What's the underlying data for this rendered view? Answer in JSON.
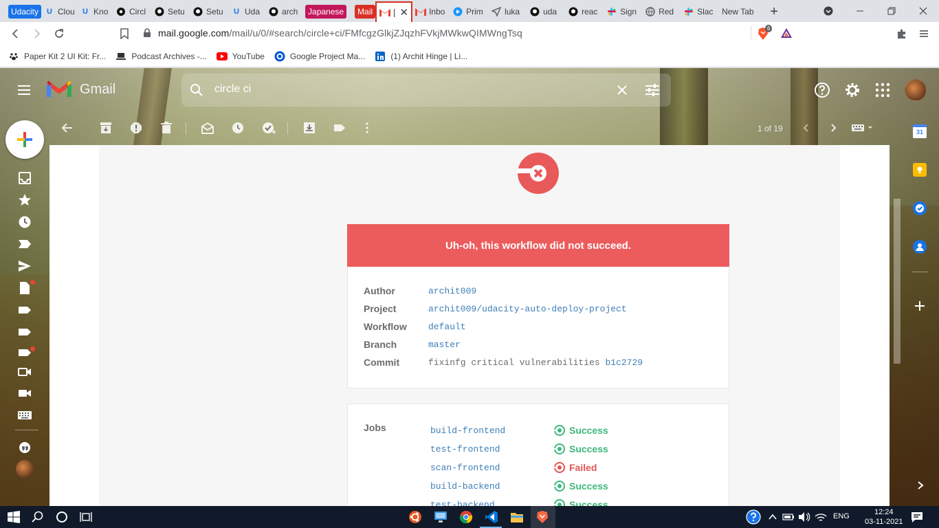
{
  "browser": {
    "tabs": [
      {
        "group": "Udacity",
        "group_color": "#1a73e8"
      },
      {
        "label": "Clou",
        "icon": "udacity-icon"
      },
      {
        "label": "Kno",
        "icon": "udacity-icon"
      },
      {
        "label": "Circl",
        "icon": "circleci-icon"
      },
      {
        "label": "Setu",
        "icon": "github-icon"
      },
      {
        "label": "Setu",
        "icon": "github-icon"
      },
      {
        "label": "Uda",
        "icon": "udacity-icon"
      },
      {
        "label": "arch",
        "icon": "github-icon"
      },
      {
        "group": "Japanese",
        "group_color": "#c2185b"
      },
      {
        "group": "Mail",
        "group_color": "#d93025"
      },
      {
        "label": "[",
        "icon": "gmail-icon",
        "active": true
      },
      {
        "label": "Inbo",
        "icon": "gmail-icon"
      },
      {
        "label": "Prim",
        "icon": "primevideo-icon"
      },
      {
        "label": "luka",
        "icon": "send-icon"
      },
      {
        "label": "uda",
        "icon": "github-icon"
      },
      {
        "label": "reac",
        "icon": "github-icon"
      },
      {
        "label": "Sign",
        "icon": "slack-icon"
      },
      {
        "label": "Red",
        "icon": "globe-icon"
      },
      {
        "label": "Slac",
        "icon": "slack-icon"
      },
      {
        "label": "New Tab",
        "icon": ""
      }
    ],
    "url_host": "mail.google.com",
    "url_path": "/mail/u/0/#search/circle+ci/FMfcgzGlkjZJqzhFVkjMWkwQIMWngTsq",
    "brave_badge": "6",
    "bookmarks": [
      {
        "label": "Paper Kit 2 UI Kit: Fr...",
        "icon": "pawprint-icon"
      },
      {
        "label": "Podcast Archives -...",
        "icon": "laptop-icon"
      },
      {
        "label": "YouTube",
        "icon": "youtube-icon"
      },
      {
        "label": "Google Project Ma...",
        "icon": "coursera-icon"
      },
      {
        "label": "(1) Archit Hinge | Li...",
        "icon": "linkedin-icon"
      }
    ]
  },
  "gmail": {
    "logo_text": "Gmail",
    "search_value": "circle ci",
    "pager": "1 of 19",
    "email": {
      "banner": "Uh-oh, this workflow did not succeed.",
      "info": [
        {
          "label": "Author",
          "value": "archit009"
        },
        {
          "label": "Project",
          "value": "archit009/udacity-auto-deploy-project"
        },
        {
          "label": "Workflow",
          "value": "default"
        },
        {
          "label": "Branch",
          "value": "master"
        },
        {
          "label": "Commit",
          "value": "fixinfg critical vulnerabilities",
          "link": "b1c2729"
        }
      ],
      "jobs_label": "Jobs",
      "jobs": [
        {
          "name": "build-frontend",
          "status": "Success"
        },
        {
          "name": "test-frontend",
          "status": "Success"
        },
        {
          "name": "scan-frontend",
          "status": "Failed"
        },
        {
          "name": "build-backend",
          "status": "Success"
        },
        {
          "name": "test-backend",
          "status": "Success"
        }
      ]
    }
  },
  "taskbar": {
    "language": "ENG",
    "time": "12:24",
    "date": "03-11-2021"
  },
  "colors": {
    "banner_red": "#ed5c5c",
    "link_blue": "#3d7fb8",
    "success_green": "#3db87b",
    "failed_red": "#e25555"
  }
}
